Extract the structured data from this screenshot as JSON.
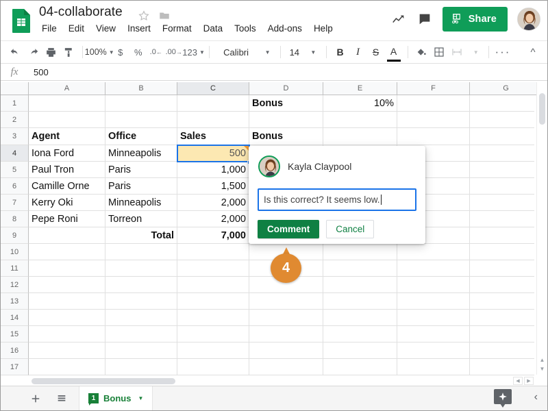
{
  "app": {
    "doc_title": "04-collaborate",
    "logo_icon": "sheets-logo-icon",
    "star_icon": "star-icon",
    "folder_icon": "folder-icon"
  },
  "menubar": {
    "items": [
      "File",
      "Edit",
      "View",
      "Insert",
      "Format",
      "Data",
      "Tools",
      "Add-ons",
      "Help"
    ]
  },
  "header_actions": {
    "trend_icon": "trending-up-icon",
    "comment_icon": "comment-icon",
    "share_label": "Share",
    "share_icon": "share-lock-icon",
    "share_color": "#0f9d58",
    "avatar": "user-avatar"
  },
  "toolbar": {
    "undo_icon": "undo-icon",
    "redo_icon": "redo-icon",
    "print_icon": "print-icon",
    "paint_icon": "paint-format-icon",
    "zoom_value": "100%",
    "currency_label": "$",
    "percent_label": "%",
    "decrease_decimal": ".0",
    "increase_decimal": ".00",
    "number_format": "123",
    "font_family_value": "Calibri",
    "font_size_value": "14",
    "bold_label": "B",
    "italic_label": "I",
    "strikethrough_label": "S",
    "text_color_label": "A",
    "text_color_swatch": "#000000",
    "fill_color_icon": "fill-color-icon",
    "borders_icon": "borders-icon",
    "merge_icon": "merge-cells-icon",
    "more_icon": "more-options-icon",
    "collapse_icon": "collapse-toolbar-icon"
  },
  "formula_bar": {
    "fx_label": "fx",
    "value": "500"
  },
  "grid": {
    "columns": [
      "A",
      "B",
      "C",
      "D",
      "E",
      "F",
      "G"
    ],
    "selected_column": "C",
    "selected_row": 4,
    "rows": [
      1,
      2,
      3,
      4,
      5,
      6,
      7,
      8,
      9,
      10,
      11,
      12,
      13,
      14,
      15,
      16,
      17
    ],
    "cells": [
      {
        "ref": "D1",
        "col": "D",
        "row": 1,
        "text": "Bonus",
        "bold": true,
        "align": "left"
      },
      {
        "ref": "E1",
        "col": "E",
        "row": 1,
        "text": "10%",
        "bold": false,
        "align": "right"
      },
      {
        "ref": "A3",
        "col": "A",
        "row": 3,
        "text": "Agent",
        "bold": true,
        "align": "left"
      },
      {
        "ref": "B3",
        "col": "B",
        "row": 3,
        "text": "Office",
        "bold": true,
        "align": "left"
      },
      {
        "ref": "C3",
        "col": "C",
        "row": 3,
        "text": "Sales",
        "bold": true,
        "align": "left"
      },
      {
        "ref": "D3",
        "col": "D",
        "row": 3,
        "text": "Bonus",
        "bold": true,
        "align": "left"
      },
      {
        "ref": "A4",
        "col": "A",
        "row": 4,
        "text": "Iona Ford",
        "bold": false,
        "align": "left"
      },
      {
        "ref": "B4",
        "col": "B",
        "row": 4,
        "text": "Minneapolis",
        "bold": false,
        "align": "left"
      },
      {
        "ref": "A5",
        "col": "A",
        "row": 5,
        "text": "Paul Tron",
        "bold": false,
        "align": "left"
      },
      {
        "ref": "B5",
        "col": "B",
        "row": 5,
        "text": "Paris",
        "bold": false,
        "align": "left"
      },
      {
        "ref": "C5",
        "col": "C",
        "row": 5,
        "text": "1,000",
        "bold": false,
        "align": "right"
      },
      {
        "ref": "A6",
        "col": "A",
        "row": 6,
        "text": "Camille Orne",
        "bold": false,
        "align": "left"
      },
      {
        "ref": "B6",
        "col": "B",
        "row": 6,
        "text": "Paris",
        "bold": false,
        "align": "left"
      },
      {
        "ref": "C6",
        "col": "C",
        "row": 6,
        "text": "1,500",
        "bold": false,
        "align": "right"
      },
      {
        "ref": "A7",
        "col": "A",
        "row": 7,
        "text": "Kerry Oki",
        "bold": false,
        "align": "left"
      },
      {
        "ref": "B7",
        "col": "B",
        "row": 7,
        "text": "Minneapolis",
        "bold": false,
        "align": "left"
      },
      {
        "ref": "C7",
        "col": "C",
        "row": 7,
        "text": "2,000",
        "bold": false,
        "align": "right"
      },
      {
        "ref": "A8",
        "col": "A",
        "row": 8,
        "text": "Pepe Roni",
        "bold": false,
        "align": "left"
      },
      {
        "ref": "B8",
        "col": "B",
        "row": 8,
        "text": "Torreon",
        "bold": false,
        "align": "left"
      },
      {
        "ref": "C8",
        "col": "C",
        "row": 8,
        "text": "2,000",
        "bold": false,
        "align": "right"
      },
      {
        "ref": "B9",
        "col": "B",
        "row": 9,
        "text": "Total",
        "bold": true,
        "align": "right"
      },
      {
        "ref": "C9",
        "col": "C",
        "row": 9,
        "text": "7,000",
        "bold": true,
        "align": "right"
      }
    ],
    "selected_cell": {
      "ref": "C4",
      "value": "500",
      "fill_color": "#fce8b2",
      "border_color": "#1a73e8",
      "has_comment_marker": true,
      "comment_marker_color": "#f09a33"
    }
  },
  "comment_popup": {
    "author": "Kayla Claypool",
    "avatar": "commenter-avatar",
    "input_value": "Is this correct? It seems low.",
    "submit_label": "Comment",
    "cancel_label": "Cancel",
    "submit_color": "#0f8043"
  },
  "step_badge": {
    "number": "4",
    "color": "#e08a31"
  },
  "bottom_bar": {
    "add_sheet_icon": "add-sheet-icon",
    "all_sheets_icon": "all-sheets-icon",
    "tab_name": "Bonus",
    "tab_comment_count": "1",
    "tab_dropdown_icon": "chevron-down-icon",
    "explore_icon": "explore-icon",
    "collapse_icon": "chevron-left-icon"
  }
}
